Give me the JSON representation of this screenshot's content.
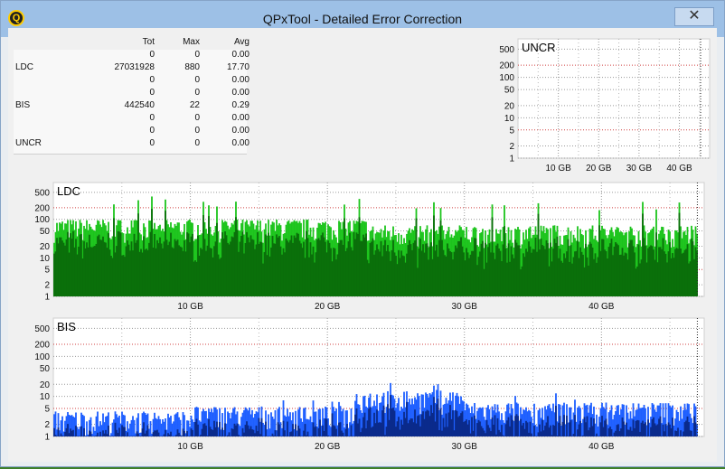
{
  "window": {
    "title": "QPxTool - Detailed Error Correction",
    "close_glyph": "✕",
    "app_icon_letter": "Q"
  },
  "stats": {
    "headers": [
      "",
      "Tot",
      "Max",
      "Avg"
    ],
    "rows": [
      {
        "label": "",
        "tot": "0",
        "max": "0",
        "avg": "0.00"
      },
      {
        "label": "LDC",
        "tot": "27031928",
        "max": "880",
        "avg": "17.70"
      },
      {
        "label": "",
        "tot": "0",
        "max": "0",
        "avg": "0.00"
      },
      {
        "label": "",
        "tot": "0",
        "max": "0",
        "avg": "0.00"
      },
      {
        "label": "BIS",
        "tot": "442540",
        "max": "22",
        "avg": "0.29"
      },
      {
        "label": "",
        "tot": "0",
        "max": "0",
        "avg": "0.00"
      },
      {
        "label": "",
        "tot": "0",
        "max": "0",
        "avg": "0.00"
      },
      {
        "label": "UNCR",
        "tot": "0",
        "max": "0",
        "avg": "0.00"
      }
    ]
  },
  "chart_data": [
    {
      "type": "area",
      "title": "UNCR",
      "y_scale": "log",
      "y_ticks": [
        "1",
        "2",
        "5",
        "10",
        "20",
        "50",
        "100",
        "200",
        "500"
      ],
      "x_ticks": [
        "10 GB",
        "20 GB",
        "30 GB",
        "40 GB"
      ],
      "series": [
        {
          "values": []
        }
      ],
      "color": "#000000"
    },
    {
      "type": "area",
      "title": "LDC",
      "y_scale": "log",
      "y_ticks": [
        "1",
        "2",
        "5",
        "10",
        "20",
        "50",
        "100",
        "200",
        "500"
      ],
      "x_ticks": [
        "10 GB",
        "20 GB",
        "30 GB",
        "40 GB"
      ],
      "x_end_gb": 47,
      "segments": [
        {
          "from_gb": 0,
          "to_gb": 23,
          "level": 70,
          "peak": 400
        },
        {
          "from_gb": 23,
          "to_gb": 47,
          "level": 50,
          "peak": 300
        }
      ],
      "colors": {
        "outer": "#1cc41c",
        "inner": "#0a6e0a"
      }
    },
    {
      "type": "area",
      "title": "BIS",
      "y_scale": "log",
      "y_ticks": [
        "1",
        "2",
        "5",
        "10",
        "20",
        "50",
        "100",
        "200",
        "500"
      ],
      "x_ticks": [
        "10 GB",
        "20 GB",
        "30 GB",
        "40 GB"
      ],
      "x_end_gb": 47,
      "segments": [
        {
          "from_gb": 0,
          "to_gb": 10,
          "level": 3,
          "peak": 6
        },
        {
          "from_gb": 10,
          "to_gb": 22,
          "level": 4,
          "peak": 8
        },
        {
          "from_gb": 22,
          "to_gb": 30,
          "level": 10,
          "peak": 22
        },
        {
          "from_gb": 30,
          "to_gb": 47,
          "level": 5,
          "peak": 12
        }
      ],
      "colors": {
        "outer": "#1e5fff",
        "inner": "#0a2a8a"
      }
    }
  ]
}
